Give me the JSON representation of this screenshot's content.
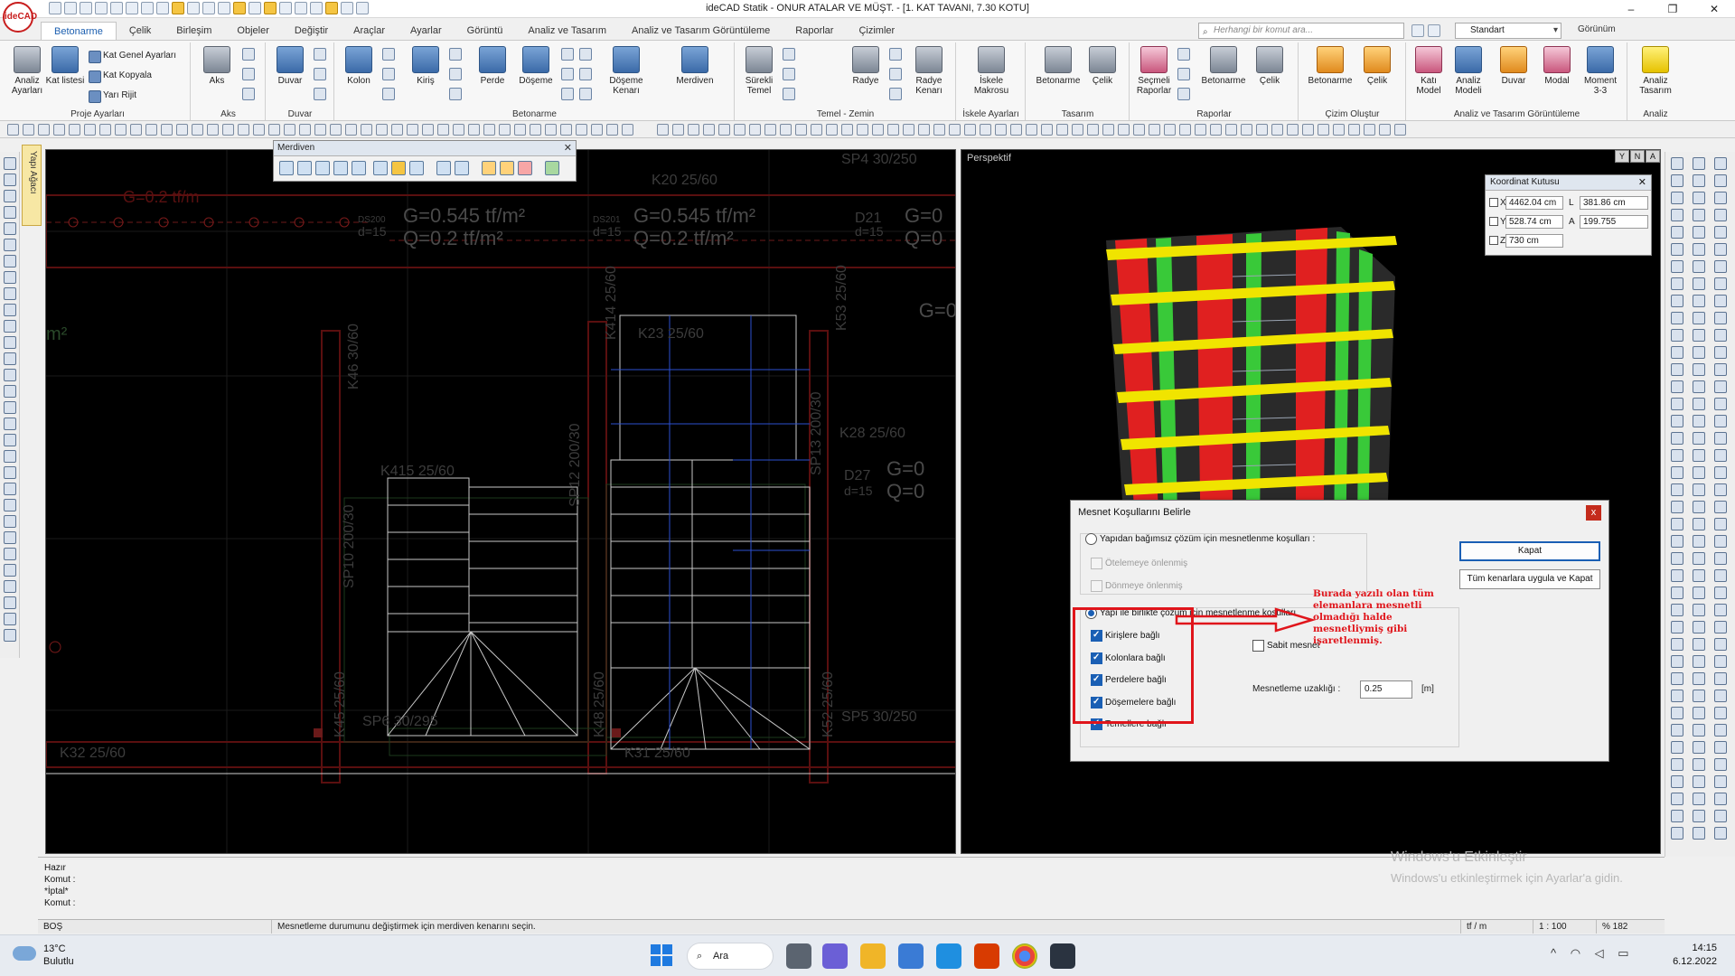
{
  "app": {
    "logo_text": "ideCAD",
    "title": "ideCAD Statik - ONUR ATALAR VE MÜŞT. - [1. KAT TAVANI,  7.30 KOTU]",
    "window_controls": [
      "–",
      "❐",
      "✕"
    ]
  },
  "ribbon_tabs": [
    "Betonarme",
    "Çelik",
    "Birleşim",
    "Objeler",
    "Değiştir",
    "Araçlar",
    "Ayarlar",
    "Görüntü",
    "Analiz ve Tasarım",
    "Analiz ve Tasarım Görüntüleme",
    "Raporlar",
    "Çizimler"
  ],
  "active_tab": "Betonarme",
  "command_search": {
    "placeholder": "Herhangi bir komut ara..."
  },
  "style_select": {
    "value": "Standart"
  },
  "view_menu": "Görünüm",
  "ribbon": {
    "proje": {
      "label": "Proje Ayarları",
      "analiz": "Analiz Ayarları",
      "kat_listesi": "Kat listesi",
      "kat_genel": "Kat Genel Ayarları",
      "kat_kopyala": "Kat Kopyala",
      "yari_rijit": "Yarı Rijit"
    },
    "aks": {
      "label": "Aks",
      "aks": "Aks"
    },
    "duvar": {
      "label": "Duvar",
      "duvar": "Duvar"
    },
    "betonarme": {
      "label": "Betonarme",
      "kolon": "Kolon",
      "kiris": "Kiriş",
      "perde": "Perde",
      "doseme": "Döşeme",
      "doseme_kenari": "Döşeme Kenarı",
      "merdiven": "Merdiven"
    },
    "temel": {
      "label": "Temel - Zemin",
      "surekli": "Sürekli Temel",
      "radye": "Radye",
      "radye_kenari": "Radye Kenarı"
    },
    "iskele": {
      "label": "İskele Ayarları",
      "makrosu": "İskele Makrosu"
    },
    "tasarim": {
      "label": "Tasarım",
      "betonarme": "Betonarme",
      "celik": "Çelik"
    },
    "raporlar": {
      "label": "Raporlar",
      "secmeli": "Seçmeli Raporlar",
      "betonarme": "Betonarme",
      "celik": "Çelik"
    },
    "cizim": {
      "label": "Çizim Oluştur",
      "betonarme": "Betonarme",
      "celik": "Çelik"
    },
    "analiz_gor": {
      "label": "Analiz ve Tasarım Görüntüleme",
      "kati_model": "Katı Model",
      "analiz_modeli": "Analiz Modeli",
      "duvar": "Duvar",
      "modal": "Modal",
      "moment": "Moment 3-3"
    },
    "analiz": {
      "label": "Analiz",
      "analiz_tasarim": "Analiz Tasarım"
    }
  },
  "merdiven_toolbar": {
    "title": "Merdiven",
    "close": "✕"
  },
  "yapi_agaci": "Yapı Ağacı",
  "cad_labels": {
    "k20": "K20 25/60",
    "sp4": "SP4 30/250",
    "g_left": "G=0.2 tf/m",
    "ds200": "DS200",
    "ds201": "DS201",
    "d15": "d=15",
    "gq1": "G=0.545 tf/m²",
    "q1": "Q=0.2 tf/m²",
    "gq2": "G=0.545 tf/m²",
    "q2": "Q=0.2 tf/m²",
    "d21": "D21",
    "gq3": "G=0",
    "q3": "Q=0",
    "k414": "K414 25/60",
    "k53": "K53 25/60",
    "k46": "K46 30/60",
    "k23": "K23 25/60",
    "sp12": "SP12 200/30",
    "sp13": "SP13 200/30",
    "k415": "K415 25/60",
    "k28": "K28 25/60",
    "sp10": "SP10 200/30",
    "d27": "D27",
    "g27": "G=0",
    "q27": "Q=0",
    "k45": "K45 25/60",
    "k48": "K48 25/60",
    "k52": "K52 25/60",
    "sp5": "SP5 30/250",
    "sp6": "SP6 30/295",
    "k32": "K32 25/60",
    "k31": "K31 25/60",
    "m2": "m²",
    "g_right": "G=0"
  },
  "perspective": {
    "label": "Perspektif",
    "view_buttons": [
      "Y",
      "N",
      "A"
    ]
  },
  "coord_box": {
    "title": "Koordinat Kutusu",
    "close": "✕",
    "x_label": "X",
    "x": "4462.04 cm",
    "l_label": "L",
    "l": "381.86 cm",
    "y_label": "Y",
    "y": "528.74 cm",
    "a_label": "A",
    "a": "199.755",
    "z_label": "Z",
    "z": "730 cm"
  },
  "dialog": {
    "title": "Mesnet Koşullarını Belirle",
    "close": "x",
    "opt_independent": "Yapıdan bağımsız çözüm için mesnetlenme koşulları :",
    "oteleme": "Ötelemeye önlenmiş",
    "donme": "Dönmeye önlenmiş",
    "opt_together": "Yapı ile birlikte çözüm için mesnetlenme koşulları",
    "kirislere": "Kirişlere bağlı",
    "kolonlara": "Kolonlara bağlı",
    "perdelere": "Perdelere bağlı",
    "dosemelere": "Döşemelere bağlı",
    "temellere": "Temellere bağlı",
    "sabit": "Sabit mesnet",
    "mesafe_label": "Mesnetleme uzaklığı :",
    "mesafe_value": "0.25",
    "mesafe_unit": "[m]",
    "btn_kapat": "Kapat",
    "btn_apply_all": "Tüm kenarlara uygula ve Kapat"
  },
  "annotation": {
    "note": "Burada yazılı olan tüm elemanlara mesnetli olmadığı halde mesnetliymiş gibi işaretlenmiş.",
    "color": "#e0151b"
  },
  "command_area": {
    "lines": [
      "Hazır",
      "Komut :",
      "*İptal*",
      "Komut :"
    ]
  },
  "watermark": {
    "line1": "Windows'u Etkinleştir",
    "line2": "Windows'u etkinleştirmek için Ayarlar'a gidin."
  },
  "status": {
    "mode": "BOŞ",
    "message": "Mesnetleme durumunu değiştirmek için merdiven kenarını seçin.",
    "unit": "tf / m",
    "scale": "1 : 100",
    "zoom": "% 182"
  },
  "taskbar": {
    "temp": "13°C",
    "weather": "Bulutlu",
    "search": "Ara",
    "time": "14:15",
    "date": "6.12.2022",
    "tray_icons": [
      "^",
      "wifi",
      "vol",
      "bat"
    ]
  }
}
